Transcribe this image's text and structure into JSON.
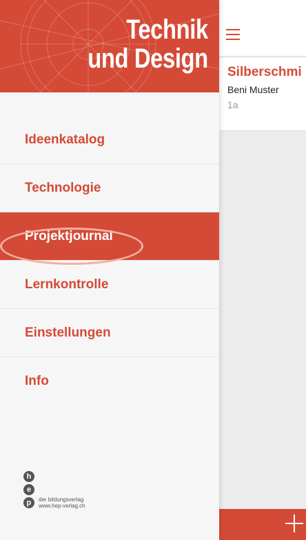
{
  "brand": {
    "line1": "Technik",
    "line2": "und Design"
  },
  "nav": {
    "items": [
      {
        "label": "Ideenkatalog"
      },
      {
        "label": "Technologie"
      },
      {
        "label": "Projektjournal",
        "active": true
      },
      {
        "label": "Lernkontrolle"
      },
      {
        "label": "Einstellungen"
      },
      {
        "label": "Info"
      }
    ]
  },
  "publisher": {
    "letters": [
      "h",
      "e",
      "p"
    ],
    "line1": "der bildungsverlag",
    "line2": "www.hep-verlag.ch"
  },
  "main": {
    "card": {
      "title": "Silberschmi",
      "author": "Beni Muster",
      "class": "1a"
    }
  },
  "colors": {
    "accent": "#d44a36",
    "highlight": "#f0b2a0"
  },
  "icons": {
    "menu": "hamburger-icon",
    "add": "plus-icon"
  }
}
